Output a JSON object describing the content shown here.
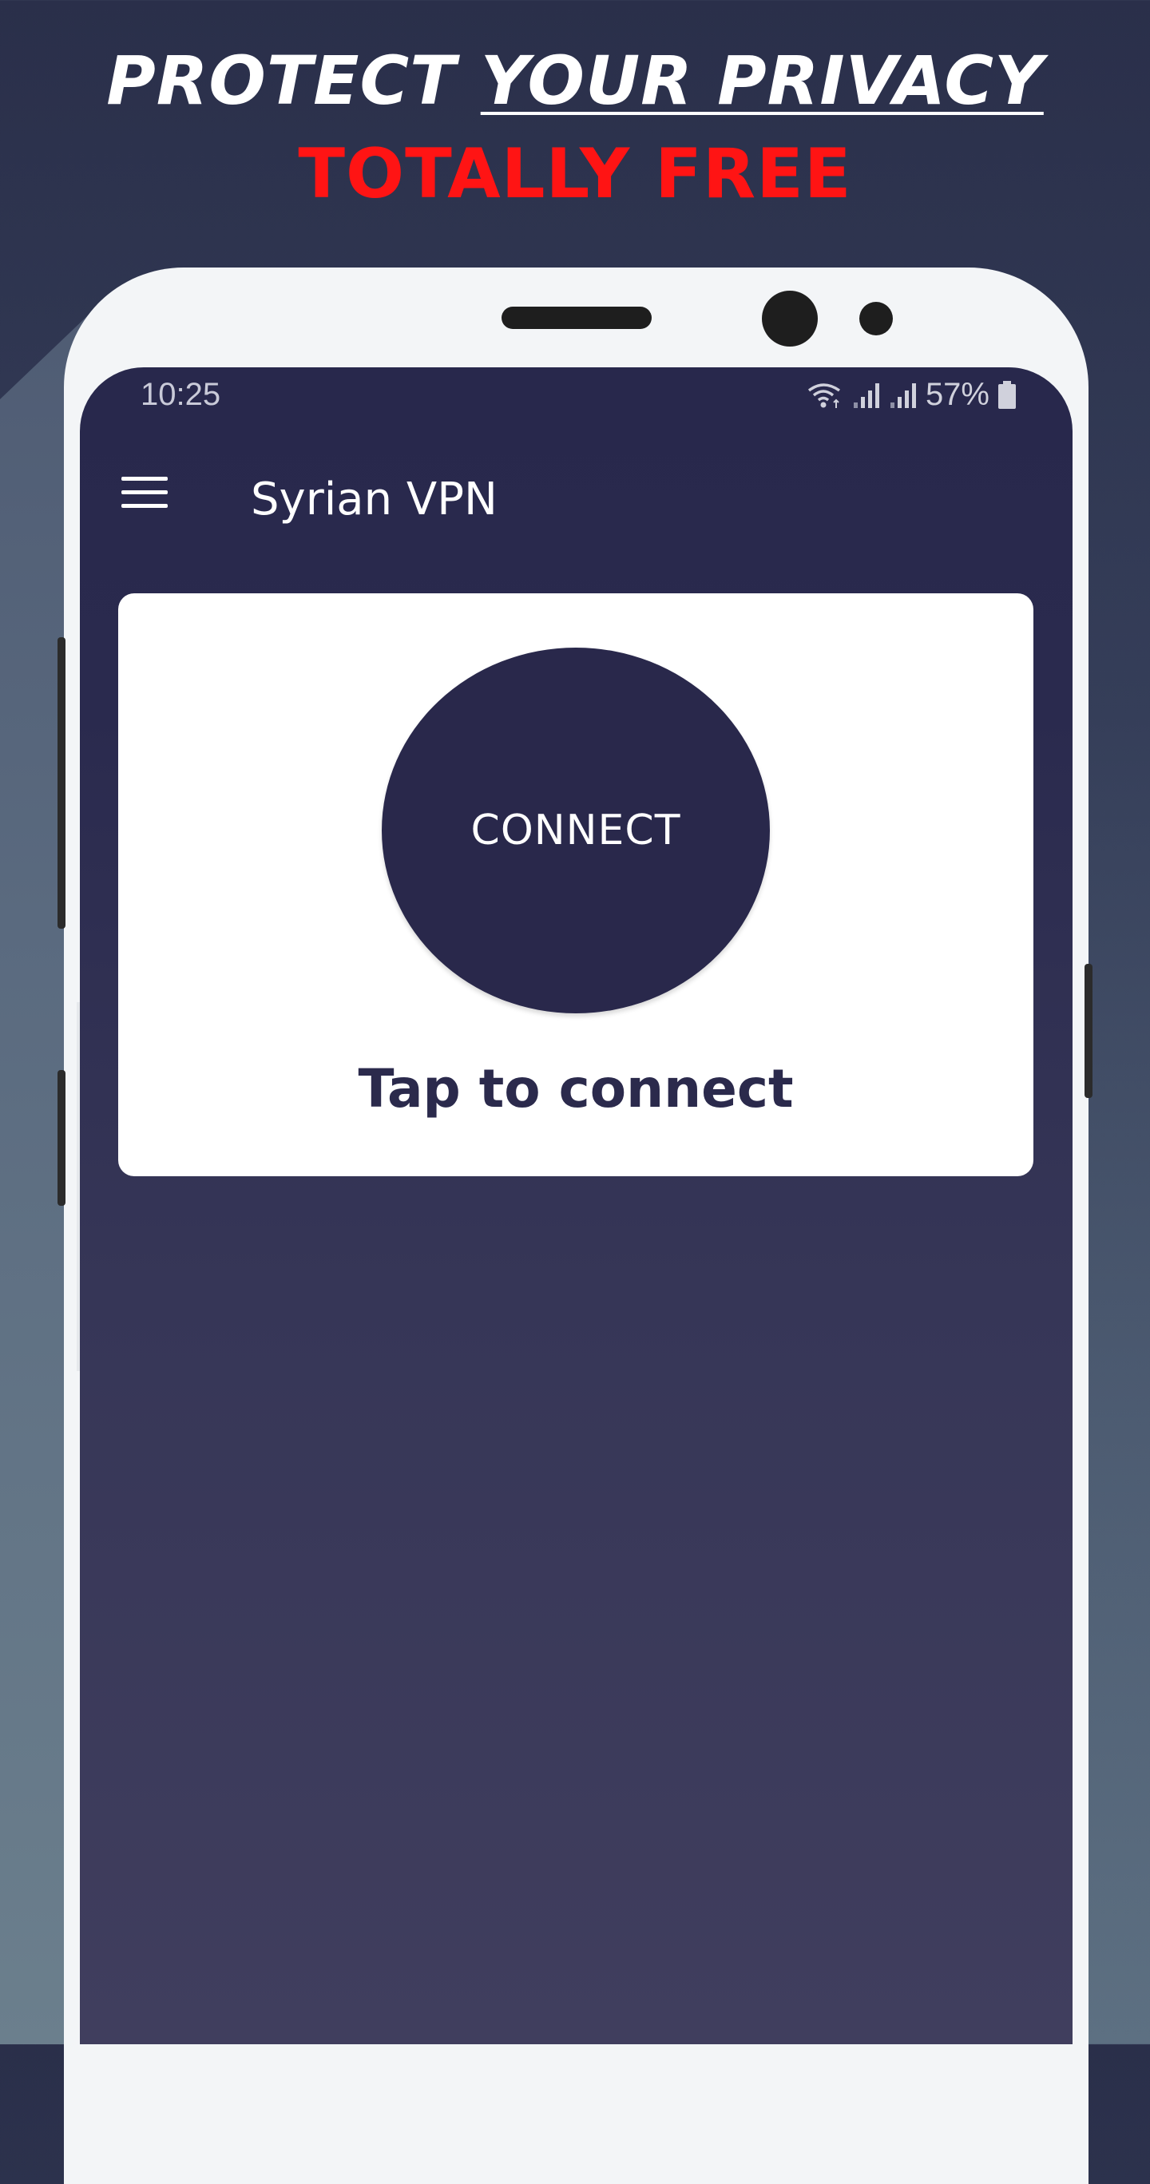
{
  "promo": {
    "headline_part1": "PROTECT ",
    "headline_part2": "YOUR PRIVACY",
    "subheadline": "TOTALLY FREE"
  },
  "status_bar": {
    "time": "10:25",
    "battery": "57%",
    "icons": [
      "wifi-icon",
      "signal-icon",
      "signal-icon",
      "battery-icon"
    ]
  },
  "app_bar": {
    "title": "Syrian VPN",
    "menu_icon": "hamburger-menu-icon"
  },
  "connect_card": {
    "button_label": "CONNECT",
    "status_text": "Tap to connect"
  },
  "colors": {
    "accent_red": "#ff1414",
    "primary_navy": "#29284b",
    "card_bg": "#ffffff"
  }
}
